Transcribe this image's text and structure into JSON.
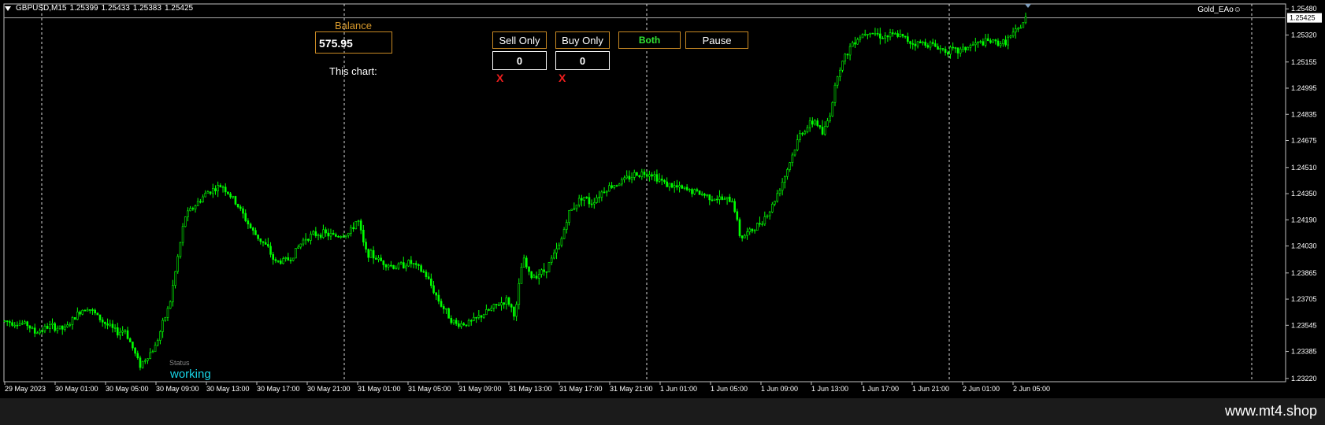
{
  "header": {
    "symbol_info": "GBPUSD,M15",
    "open": "1.25399",
    "high": "1.25433",
    "low": "1.25383",
    "close": "1.25425",
    "ea_name": "Gold_EAo",
    "ea_icon": "smiley-icon"
  },
  "panel": {
    "balance_title": "Balance",
    "balance_value": "575.95",
    "this_chart_label": "This chart:",
    "sell_only_label": "Sell Only",
    "buy_only_label": "Buy Only",
    "both_label": "Both",
    "pause_label": "Pause",
    "sell_count": "0",
    "buy_count": "0",
    "close_mark": "X",
    "both_color": "#32e632",
    "border_color": "#c98a24",
    "close_color": "#f01e1e"
  },
  "status": {
    "label": "Status",
    "value": "working",
    "value_color": "#17d4e6"
  },
  "footer": {
    "watermark": "www.mt4.shop"
  },
  "chart_data": {
    "type": "candlestick",
    "symbol": "GBPUSD",
    "timeframe": "M15",
    "candle_color": "#00ff00",
    "background": "#000000",
    "price_axis_ticks": [
      "1.25480",
      "1.25320",
      "1.25155",
      "1.24995",
      "1.24835",
      "1.24675",
      "1.24510",
      "1.24350",
      "1.24190",
      "1.24030",
      "1.23865",
      "1.23705",
      "1.23545",
      "1.23385",
      "1.23220"
    ],
    "ylim": [
      1.232,
      1.2551
    ],
    "current_price_label": "1.25425",
    "time_axis_ticks": [
      "29 May 2023",
      "30 May 01:00",
      "30 May 05:00",
      "30 May 09:00",
      "30 May 13:00",
      "30 May 17:00",
      "30 May 21:00",
      "31 May 01:00",
      "31 May 05:00",
      "31 May 09:00",
      "31 May 13:00",
      "31 May 17:00",
      "31 May 21:00",
      "1 Jun 01:00",
      "1 Jun 05:00",
      "1 Jun 09:00",
      "1 Jun 13:00",
      "1 Jun 17:00",
      "1 Jun 21:00",
      "2 Jun 01:00",
      "2 Jun 05:00"
    ],
    "day_separators": [
      "30 May",
      "31 May",
      "1 Jun",
      "2 Jun"
    ],
    "price_path_keypoints": [
      [
        0,
        1.2357
      ],
      [
        3,
        1.2355
      ],
      [
        4,
        1.235
      ],
      [
        6,
        1.2354
      ],
      [
        8,
        1.2352
      ],
      [
        10,
        1.2363
      ],
      [
        11,
        1.2366
      ],
      [
        13,
        1.2357
      ],
      [
        15,
        1.235
      ],
      [
        16,
        1.2352
      ],
      [
        18,
        1.233
      ],
      [
        20,
        1.2341
      ],
      [
        22,
        1.2368
      ],
      [
        24,
        1.2421
      ],
      [
        27,
        1.2436
      ],
      [
        29,
        1.244
      ],
      [
        31,
        1.2428
      ],
      [
        33,
        1.2412
      ],
      [
        35,
        1.2402
      ],
      [
        36,
        1.2393
      ],
      [
        38,
        1.2395
      ],
      [
        40,
        1.2408
      ],
      [
        42,
        1.2411
      ],
      [
        44,
        1.2409
      ],
      [
        46,
        1.2411
      ],
      [
        47,
        1.242
      ],
      [
        48,
        1.24
      ],
      [
        50,
        1.2394
      ],
      [
        52,
        1.239
      ],
      [
        54,
        1.2393
      ],
      [
        56,
        1.2386
      ],
      [
        58,
        1.2368
      ],
      [
        60,
        1.2355
      ],
      [
        62,
        1.2356
      ],
      [
        64,
        1.2362
      ],
      [
        66,
        1.2368
      ],
      [
        67,
        1.237
      ],
      [
        68,
        1.236
      ],
      [
        69,
        1.2396
      ],
      [
        70,
        1.2384
      ],
      [
        72,
        1.2388
      ],
      [
        74,
        1.2404
      ],
      [
        75,
        1.2422
      ],
      [
        77,
        1.2434
      ],
      [
        78,
        1.2429
      ],
      [
        80,
        1.2438
      ],
      [
        82,
        1.2442
      ],
      [
        84,
        1.2447
      ],
      [
        86,
        1.2448
      ],
      [
        88,
        1.2441
      ],
      [
        90,
        1.2438
      ],
      [
        92,
        1.2436
      ],
      [
        94,
        1.2433
      ],
      [
        96,
        1.2431
      ],
      [
        97,
        1.2431
      ],
      [
        98,
        1.2408
      ],
      [
        100,
        1.2414
      ],
      [
        102,
        1.2425
      ],
      [
        104,
        1.2447
      ],
      [
        106,
        1.2472
      ],
      [
        108,
        1.248
      ],
      [
        109,
        1.2471
      ],
      [
        110,
        1.2485
      ],
      [
        111,
        1.251
      ],
      [
        113,
        1.2528
      ],
      [
        115,
        1.2535
      ],
      [
        117,
        1.2531
      ],
      [
        119,
        1.2532
      ],
      [
        121,
        1.2527
      ],
      [
        123,
        1.2527
      ],
      [
        125,
        1.2523
      ],
      [
        127,
        1.2522
      ],
      [
        129,
        1.2526
      ],
      [
        131,
        1.2528
      ],
      [
        133,
        1.2527
      ],
      [
        135,
        1.2535
      ],
      [
        136,
        1.2542
      ]
    ]
  }
}
